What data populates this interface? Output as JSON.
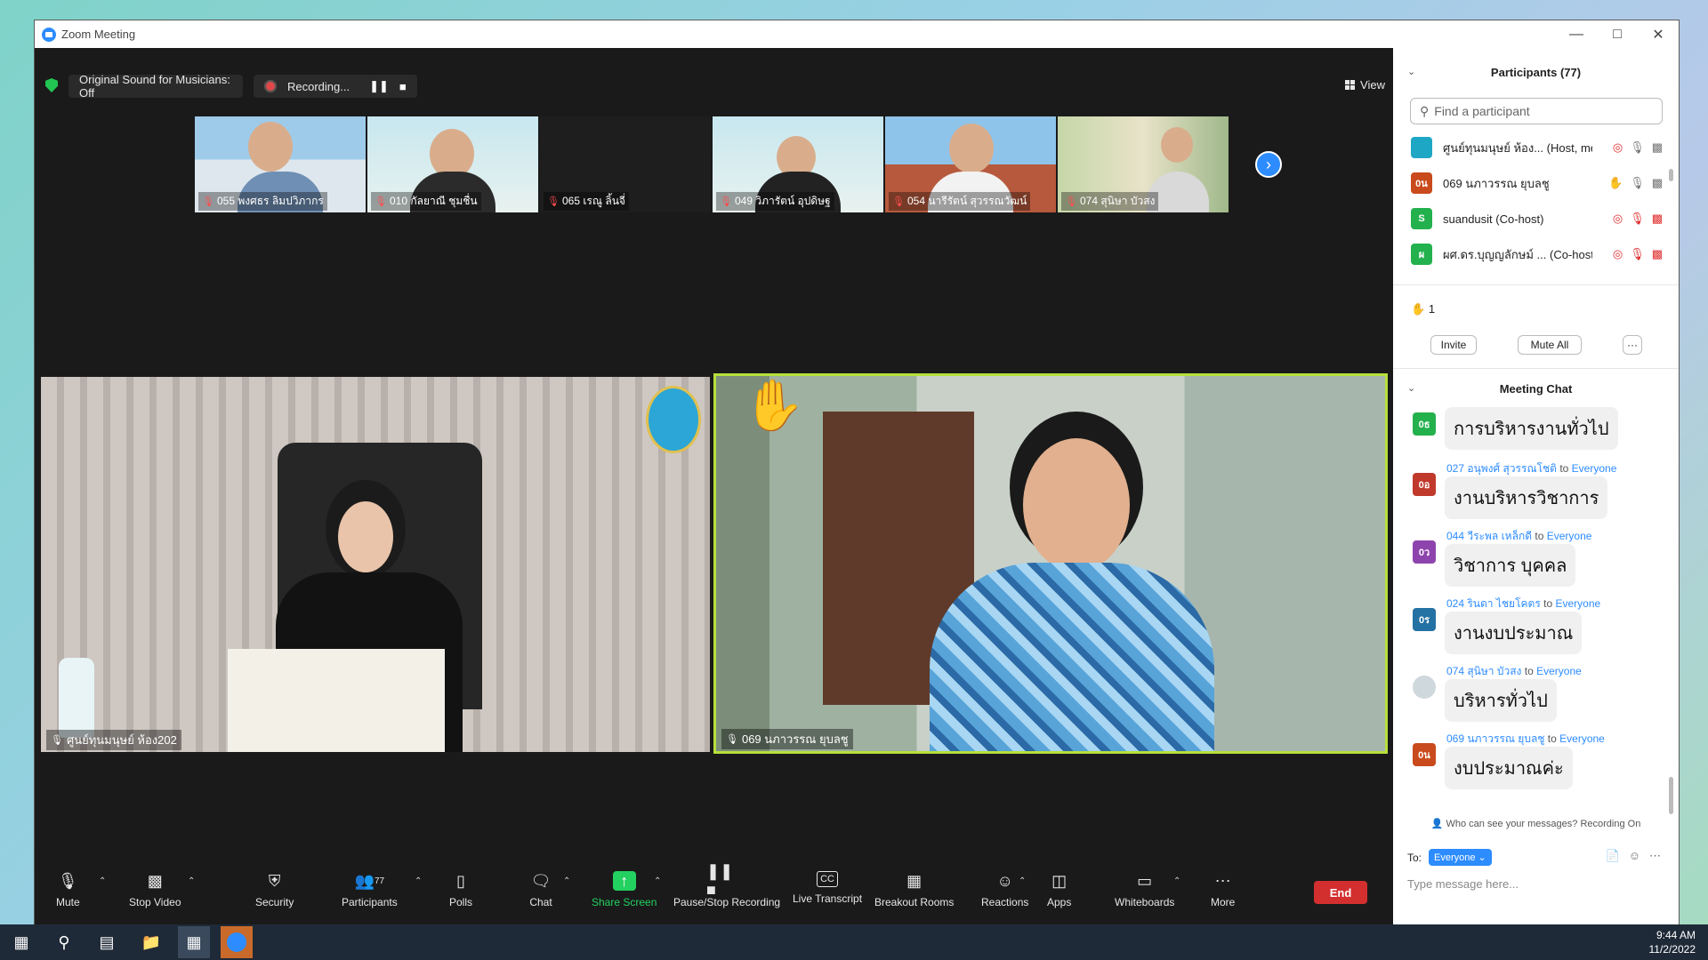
{
  "window": {
    "title": "Zoom Meeting"
  },
  "topbar": {
    "original_sound": "Original Sound for Musicians: Off",
    "recording": "Recording...",
    "view_label": "View"
  },
  "thumbnails": [
    {
      "name": "055 พงศธร ลิมปวิภากร"
    },
    {
      "name": "010 กัลยาณี ชุมชื่น"
    },
    {
      "name": "065 เรณู ลิ้นจี่"
    },
    {
      "name": "049 วิภารัตน์ อุปดิษฐ"
    },
    {
      "name": "054 นารีรัตน์ สุวรรณวัฒน์"
    },
    {
      "name": "074 สุนิษา บัวสง"
    }
  ],
  "main_tiles": {
    "left_name": "ศูนย์ทุนมนุษย์ ห้อง202",
    "right_name": "069 นภาวรรณ ยุบลชู"
  },
  "toolbar": {
    "mute": "Mute",
    "stop_video": "Stop Video",
    "security": "Security",
    "participants": "Participants",
    "participants_count": "77",
    "polls": "Polls",
    "chat": "Chat",
    "share_screen": "Share Screen",
    "pause_stop": "Pause/Stop Recording",
    "live_transcript": "Live Transcript",
    "breakout": "Breakout Rooms",
    "reactions": "Reactions",
    "apps": "Apps",
    "whiteboards": "Whiteboards",
    "more": "More",
    "end": "End"
  },
  "participants_panel": {
    "title": "Participants (77)",
    "search_placeholder": "Find a participant",
    "rows": [
      {
        "initials": "",
        "name": "ศูนย์ทุนมนุษย์ ห้อง...",
        "role": "(Host, me)",
        "color": "#1ea7c5"
      },
      {
        "initials": "0น",
        "name": "069 นภาวรรณ ยุบลชู",
        "role": "",
        "color": "#c94a1c"
      },
      {
        "initials": "S",
        "name": "suandusit",
        "role": "(Co-host)",
        "color": "#23b14d"
      },
      {
        "initials": "ผ",
        "name": "ผศ.ดร.บุญญลักษม์ ...",
        "role": "(Co-host)",
        "color": "#23b14d"
      }
    ],
    "hand_count": "1",
    "invite": "Invite",
    "mute_all": "Mute All",
    "more": "···"
  },
  "chat": {
    "title": "Meeting Chat",
    "messages": [
      {
        "initials": "0ธ",
        "color": "#23b14d",
        "sender": "",
        "to": "",
        "recipient": "",
        "text": "การบริหารงานทั่วไป"
      },
      {
        "initials": "0อ",
        "color": "#c0392b",
        "sender": "027 อนุพงศ์ สุวรรณโชติ",
        "to": "to",
        "recipient": "Everyone",
        "text": "งานบริหารวิชาการ"
      },
      {
        "initials": "0ว",
        "color": "#8e44ad",
        "sender": "044 วีระพล เหล็กดี",
        "to": "to",
        "recipient": "Everyone",
        "text": "วิชาการ บุคคล"
      },
      {
        "initials": "0ร",
        "color": "#2471a3",
        "sender": "024 รินดา ไชยโคตร",
        "to": "to",
        "recipient": "Everyone",
        "text": "งานงบประมาณ"
      },
      {
        "initials": "",
        "color": "#cfd8dc",
        "sender": "074 สุนิษา บัวสง",
        "to": "to",
        "recipient": "Everyone",
        "text": "บริหารทั่วไป"
      },
      {
        "initials": "0น",
        "color": "#c94a1c",
        "sender": "069 นภาวรรณ ยุบลชู",
        "to": "to",
        "recipient": "Everyone",
        "text": "งบประมาณค่ะ"
      }
    ],
    "who_can_see": "Who can see your messages? Recording On",
    "to_label": "To:",
    "to_value": "Everyone",
    "input_placeholder": "Type message here..."
  },
  "taskbar": {
    "time": "9:44 AM",
    "date": "11/2/2022"
  }
}
